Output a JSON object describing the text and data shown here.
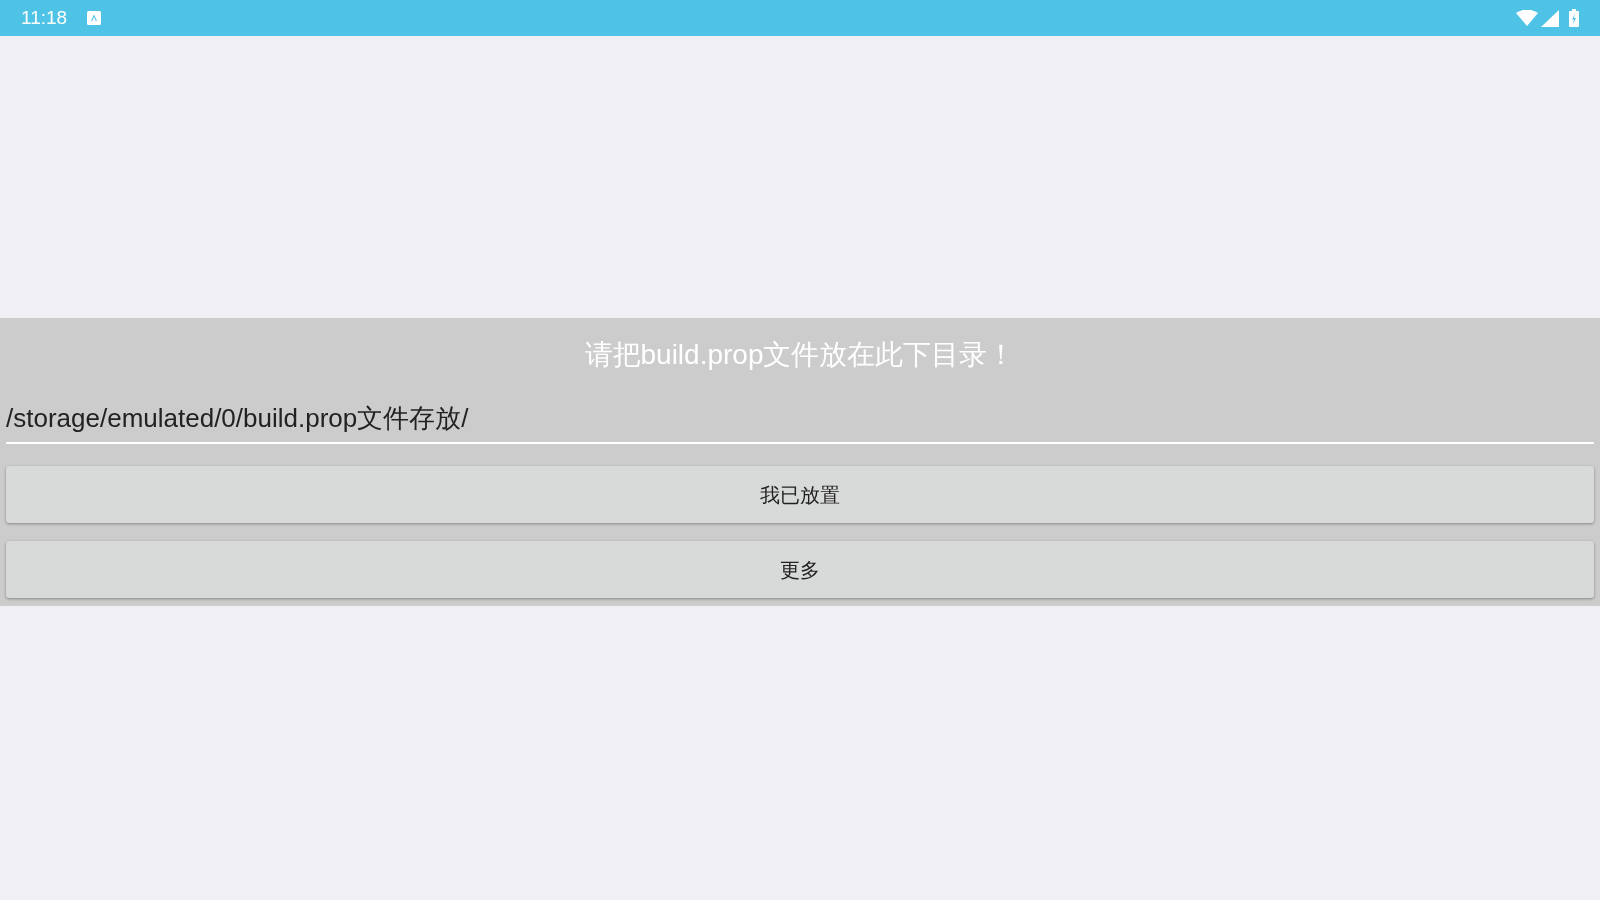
{
  "status_bar": {
    "time": "11:18"
  },
  "dialog": {
    "title": "请把build.prop文件放在此下目录！",
    "path_field": {
      "value": "/storage/emulated/0/build.prop文件存放/"
    },
    "buttons": [
      "我已放置",
      "更多"
    ]
  }
}
